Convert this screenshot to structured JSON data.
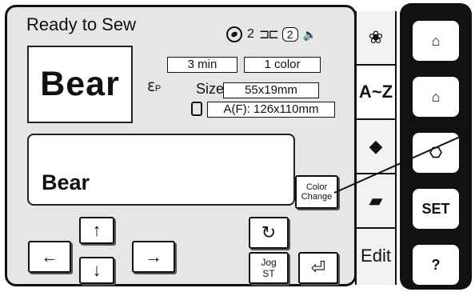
{
  "header": {
    "title": "Ready to Sew",
    "needle_count": "2",
    "bobbin_count": "2"
  },
  "preview": {
    "text": "Bear"
  },
  "info": {
    "time": "3 min",
    "colors": "1 color",
    "size_label": "Size",
    "size_value": "55x19mm",
    "hoop_value": "A(F): 126x110mm",
    "foot_label": "P"
  },
  "text_area": {
    "text": "Bear"
  },
  "buttons": {
    "color_change": "Color Change",
    "jog_label": "Jog",
    "st_label": "ST"
  },
  "tabs": {
    "az": "A~Z",
    "edit": "Edit"
  },
  "side": {
    "set": "SET",
    "help": "?"
  },
  "icons": {
    "up": "↑",
    "down": "↓",
    "left": "←",
    "right": "→",
    "rotate": "↻",
    "return": "⏎",
    "needle": "needle-icon",
    "speaker": "speaker-icon"
  }
}
